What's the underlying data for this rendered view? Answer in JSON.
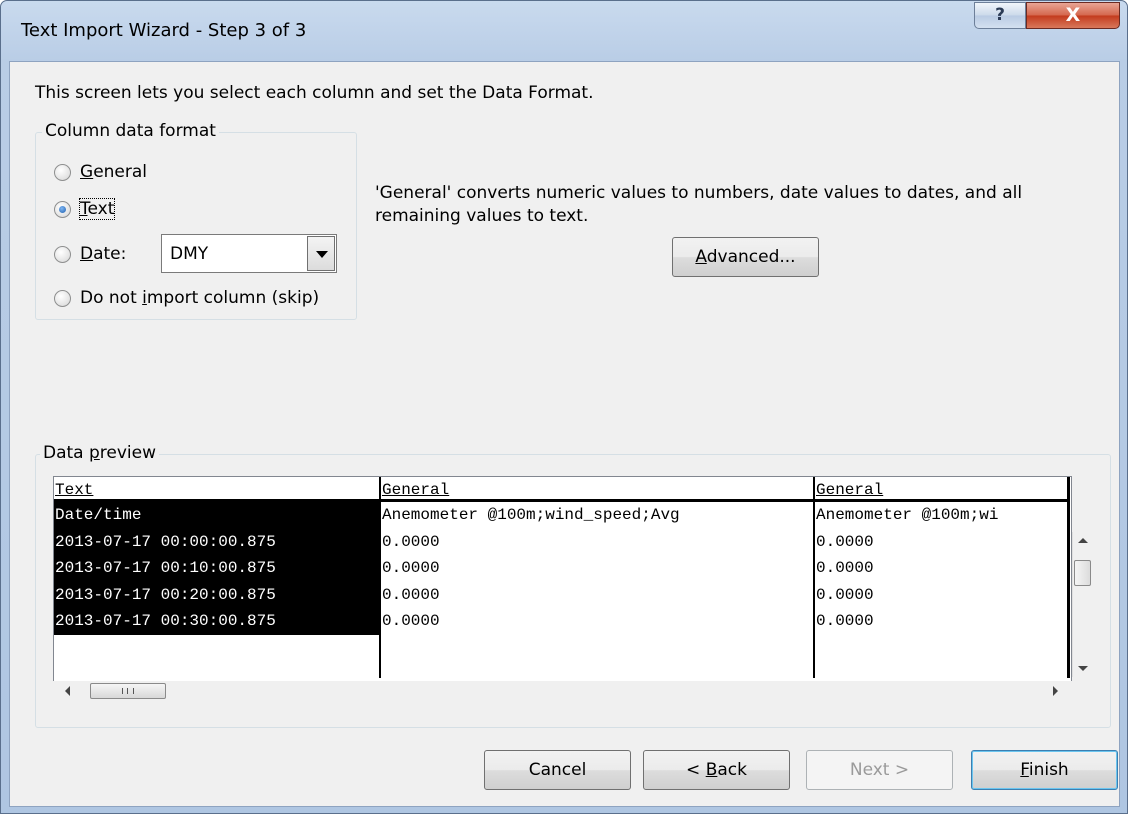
{
  "window": {
    "title": "Text Import Wizard - Step 3 of 3",
    "help_label": "?",
    "close_label": "X"
  },
  "intro_text": "This screen lets you select each column and set the Data Format.",
  "column_format": {
    "legend": "Column data format",
    "options": [
      {
        "accel": "G",
        "rest": "eneral",
        "checked": false
      },
      {
        "accel": "T",
        "rest": "ext",
        "checked": true
      },
      {
        "accel": "D",
        "rest": "ate:",
        "checked": false
      },
      {
        "pre": "Do not ",
        "accel": "i",
        "rest": "mport column (skip)",
        "checked": false
      }
    ],
    "date_order_value": "DMY"
  },
  "description": "'General' converts numeric values to numbers, date values to dates, and all remaining values to text.",
  "advanced_button": {
    "accel": "A",
    "rest": "dvanced..."
  },
  "data_preview": {
    "legend_pre": "Data ",
    "legend_accel": "p",
    "legend_rest": "review",
    "columns": [
      {
        "header": "Text",
        "selected": true,
        "cells": [
          "Date/time",
          "2013-07-17 00:00:00.875",
          "2013-07-17 00:10:00.875",
          "2013-07-17 00:20:00.875",
          "2013-07-17 00:30:00.875"
        ]
      },
      {
        "header": "General",
        "selected": false,
        "cells": [
          "Anemometer @100m;wind_speed;Avg",
          "0.0000",
          "0.0000",
          "0.0000",
          "0.0000"
        ]
      },
      {
        "header": "General",
        "selected": false,
        "cells": [
          "Anemometer @100m;wi",
          "0.0000",
          "0.0000",
          "0.0000",
          "0.0000"
        ]
      }
    ],
    "hscroll_thumb_label": "III"
  },
  "buttons": {
    "cancel": "Cancel",
    "back_pre": "< ",
    "back_accel": "B",
    "back_rest": "ack",
    "next": "Next >",
    "finish_accel": "F",
    "finish_rest": "inish"
  }
}
